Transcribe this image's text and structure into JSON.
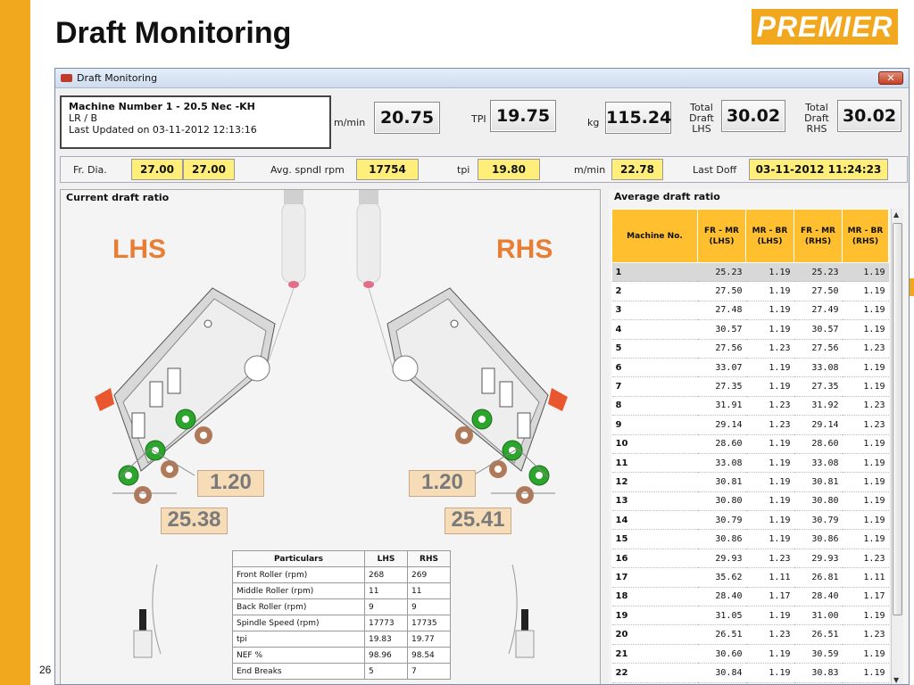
{
  "slide": {
    "title": "Draft Monitoring",
    "logo": "PREMIER",
    "page_number": "26"
  },
  "window": {
    "title": "Draft Monitoring",
    "close_label": "✕"
  },
  "machine": {
    "line1": "Machine Number 1  -  20.5 Nec -KH",
    "line2": "LR / B",
    "line3": "Last Updated on 03-11-2012 12:13:16"
  },
  "metrics": {
    "mmin_label": "m/min",
    "mmin_value": "20.75",
    "tpi_label": "TPI",
    "tpi_value": "19.75",
    "kg_label": "kg",
    "kg_value": "115.24",
    "total_draft_lhs_l1": "Total",
    "total_draft_lhs_l2": "Draft",
    "total_draft_lhs_l3": "LHS",
    "total_draft_lhs_value": "30.02",
    "total_draft_rhs_l1": "Total",
    "total_draft_rhs_l2": "Draft",
    "total_draft_rhs_l3": "RHS",
    "total_draft_rhs_value": "30.02"
  },
  "infobar": {
    "fr_dia_label": "Fr. Dia.",
    "fr_dia_1": "27.00",
    "fr_dia_2": "27.00",
    "avg_spndl_label": "Avg. spndl rpm",
    "avg_spndl_value": "17754",
    "tpi_label": "tpi",
    "tpi_value": "19.80",
    "mmin_label": "m/min",
    "mmin_value": "22.78",
    "last_doff_label": "Last Doff",
    "last_doff_value": "03-11-2012 11:24:23"
  },
  "current_panel": {
    "title": "Current draft ratio",
    "lhs_label": "LHS",
    "rhs_label": "RHS",
    "lhs_ratio_small": "1.20",
    "lhs_ratio_big": "25.38",
    "rhs_ratio_small": "1.20",
    "rhs_ratio_big": "25.41"
  },
  "particulars": {
    "headers": [
      "Particulars",
      "LHS",
      "RHS"
    ],
    "rows": [
      [
        "Front Roller (rpm)",
        "268",
        "269"
      ],
      [
        "Middle Roller (rpm)",
        "11",
        "11"
      ],
      [
        "Back Roller (rpm)",
        "9",
        "9"
      ],
      [
        "Spindle Speed (rpm)",
        "17773",
        "17735"
      ],
      [
        "tpi",
        "19.83",
        "19.77"
      ],
      [
        "NEF %",
        "98.96",
        "98.54"
      ],
      [
        "End Breaks",
        "5",
        "7"
      ]
    ]
  },
  "average_panel": {
    "title": "Average draft ratio",
    "headers": [
      "Machine No.",
      "FR - MR (LHS)",
      "MR - BR (LHS)",
      "FR - MR (RHS)",
      "MR - BR (RHS)"
    ],
    "rows": [
      [
        "1",
        "25.23",
        "1.19",
        "25.23",
        "1.19"
      ],
      [
        "2",
        "27.50",
        "1.19",
        "27.50",
        "1.19"
      ],
      [
        "3",
        "27.48",
        "1.19",
        "27.49",
        "1.19"
      ],
      [
        "4",
        "30.57",
        "1.19",
        "30.57",
        "1.19"
      ],
      [
        "5",
        "27.56",
        "1.23",
        "27.56",
        "1.23"
      ],
      [
        "6",
        "33.07",
        "1.19",
        "33.08",
        "1.19"
      ],
      [
        "7",
        "27.35",
        "1.19",
        "27.35",
        "1.19"
      ],
      [
        "8",
        "31.91",
        "1.23",
        "31.92",
        "1.23"
      ],
      [
        "9",
        "29.14",
        "1.23",
        "29.14",
        "1.23"
      ],
      [
        "10",
        "28.60",
        "1.19",
        "28.60",
        "1.19"
      ],
      [
        "11",
        "33.08",
        "1.19",
        "33.08",
        "1.19"
      ],
      [
        "12",
        "30.81",
        "1.19",
        "30.81",
        "1.19"
      ],
      [
        "13",
        "30.80",
        "1.19",
        "30.80",
        "1.19"
      ],
      [
        "14",
        "30.79",
        "1.19",
        "30.79",
        "1.19"
      ],
      [
        "15",
        "30.86",
        "1.19",
        "30.86",
        "1.19"
      ],
      [
        "16",
        "29.93",
        "1.23",
        "29.93",
        "1.23"
      ],
      [
        "17",
        "35.62",
        "1.11",
        "26.81",
        "1.11"
      ],
      [
        "18",
        "28.40",
        "1.17",
        "28.40",
        "1.17"
      ],
      [
        "19",
        "31.05",
        "1.19",
        "31.00",
        "1.19"
      ],
      [
        "20",
        "26.51",
        "1.23",
        "26.51",
        "1.23"
      ],
      [
        "21",
        "30.60",
        "1.19",
        "30.59",
        "1.19"
      ],
      [
        "22",
        "30.84",
        "1.19",
        "30.83",
        "1.19"
      ]
    ]
  },
  "colors": {
    "accent": "#f1a81e",
    "header_orange": "#ffbf2e",
    "value_yellow": "#ffef7a",
    "ratio_orange": "#e87e34",
    "roller_green": "#2ca52c",
    "roller_brown": "#b07a5a"
  }
}
